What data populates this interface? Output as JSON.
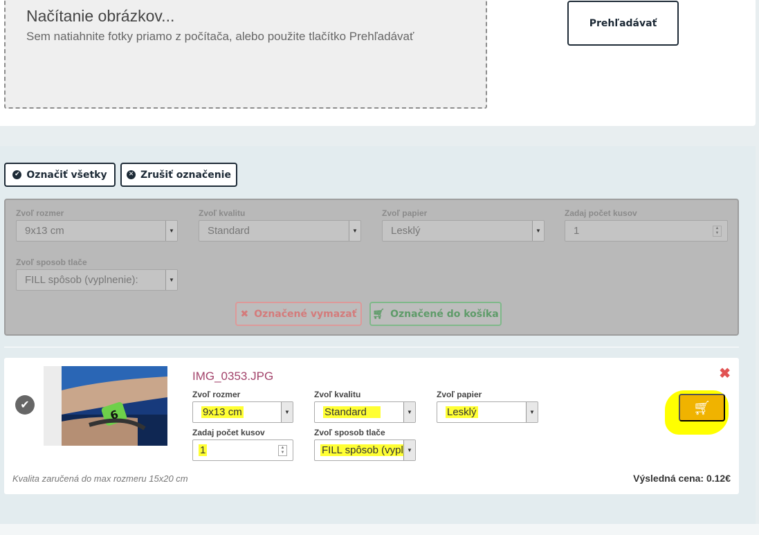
{
  "upload": {
    "title": "Načítanie obrázkov...",
    "subtitle": "Sem natiahnite fotky priamo z počítača, alebo použite tlačítko Prehľadávať",
    "browse_label": "Prehľadávať"
  },
  "selection": {
    "select_all": "Označiť všetky",
    "deselect": "Zrušiť označenie"
  },
  "bulk": {
    "size_label": "Zvoľ rozmer",
    "size_value": "9x13 cm",
    "quality_label": "Zvoľ kvalitu",
    "quality_value": "Standard",
    "paper_label": "Zvoľ papier",
    "paper_value": "Lesklý",
    "count_label": "Zadaj počet kusov",
    "count_value": "1",
    "method_label": "Zvoľ sposob tlače",
    "method_value": "FILL spôsob (vyplnenie):",
    "delete_selected": "Označené vymazať",
    "add_selected": "Označené do košíka"
  },
  "item": {
    "filename": "IMG_0353.JPG",
    "size_label": "Zvoľ rozmer",
    "size_value": "9x13 cm",
    "quality_label": "Zvoľ kvalitu",
    "quality_value": "Standard",
    "paper_label": "Zvoľ papier",
    "paper_value": "Lesklý",
    "count_label": "Zadaj počet kusov",
    "count_value": "1",
    "method_label": "Zvoľ sposob tlače",
    "method_value": "FILL spôsob (vypl",
    "quality_note": "Kvalita zaručená do max rozmeru 15x20 cm",
    "price_label": "Výsledná cena:",
    "price_value": "0.12€"
  },
  "colors": {
    "dark": "#1d2a36",
    "accent_cart": "#f0b300",
    "remove": "#e15353",
    "highlight": "#ffff33",
    "filename": "#a2426a"
  }
}
